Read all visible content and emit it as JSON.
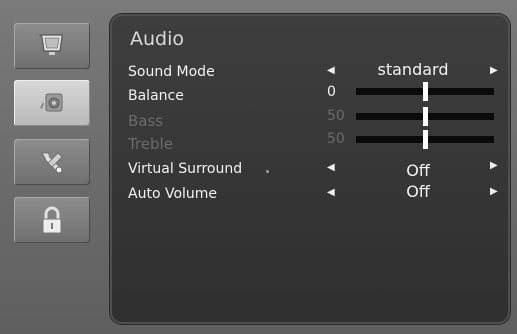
{
  "sidebar": {
    "items": [
      {
        "icon": "tv-icon",
        "active": false
      },
      {
        "icon": "audio-speaker-icon",
        "active": true
      },
      {
        "icon": "tools-icon",
        "active": false
      },
      {
        "icon": "lock-icon",
        "active": false
      }
    ]
  },
  "panel": {
    "title": "Audio",
    "rows": {
      "sound_mode": {
        "label": "Sound Mode",
        "value": "standard"
      },
      "balance": {
        "label": "Balance",
        "value": 0,
        "level": 0.5
      },
      "bass": {
        "label": "Bass",
        "value": 50,
        "level": 0.5,
        "disabled": true
      },
      "treble": {
        "label": "Treble",
        "value": 50,
        "level": 0.5,
        "disabled": true
      },
      "virtual_surround": {
        "label": "Virtual Surround",
        "value": "Off"
      },
      "auto_volume": {
        "label": "Auto Volume",
        "value": "Off"
      }
    },
    "arrow_left": "◀",
    "arrow_right": "▶"
  }
}
